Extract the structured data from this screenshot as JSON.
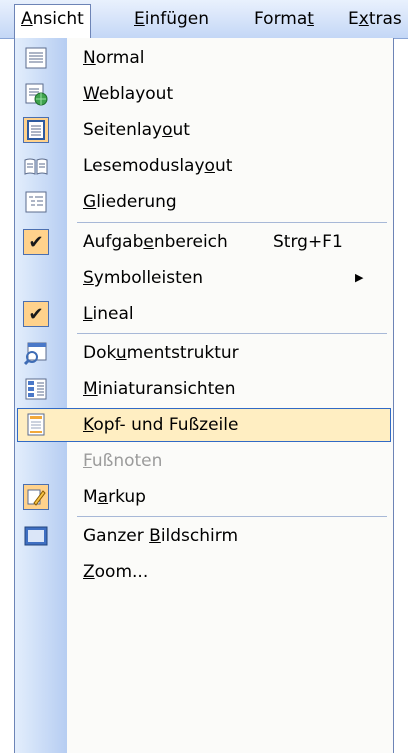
{
  "menubar": {
    "items": [
      {
        "before": "",
        "accel": "A",
        "after": "nsicht"
      },
      {
        "before": "",
        "accel": "E",
        "after": "infügen"
      },
      {
        "before": "Forma",
        "accel": "t",
        "after": ""
      },
      {
        "before": "E",
        "accel": "x",
        "after": "tras"
      }
    ]
  },
  "menu": {
    "items": [
      {
        "before": "",
        "accel": "N",
        "after": "ormal"
      },
      {
        "before": "",
        "accel": "W",
        "after": "eblayout"
      },
      {
        "before": "Seitenlay",
        "accel": "o",
        "after": "ut"
      },
      {
        "before": "Lesemoduslay",
        "accel": "o",
        "after": "ut"
      },
      {
        "before": "",
        "accel": "G",
        "after": "liederung"
      },
      {
        "before": "Aufgab",
        "accel": "e",
        "after": "nbereich",
        "shortcut": "Strg+F1"
      },
      {
        "before": "",
        "accel": "S",
        "after": "ymbolleisten",
        "submenu_arrow": "▶"
      },
      {
        "before": "",
        "accel": "L",
        "after": "ineal"
      },
      {
        "before": "Dok",
        "accel": "u",
        "after": "mentstruktur"
      },
      {
        "before": "",
        "accel": "M",
        "after": "iniaturansichten"
      },
      {
        "before": "",
        "accel": "K",
        "after": "opf- und Fußzeile"
      },
      {
        "before": "",
        "accel": "F",
        "after": "ußnoten",
        "disabled": true
      },
      {
        "before": "M",
        "accel": "a",
        "after": "rkup"
      },
      {
        "before": "Ganzer ",
        "accel": "B",
        "after": "ildschirm"
      },
      {
        "before": "",
        "accel": "Z",
        "after": "oom..."
      }
    ],
    "checkmark": "✔",
    "highlight_color": "#ffeec2",
    "gutter_color": "#c4d7f6"
  }
}
